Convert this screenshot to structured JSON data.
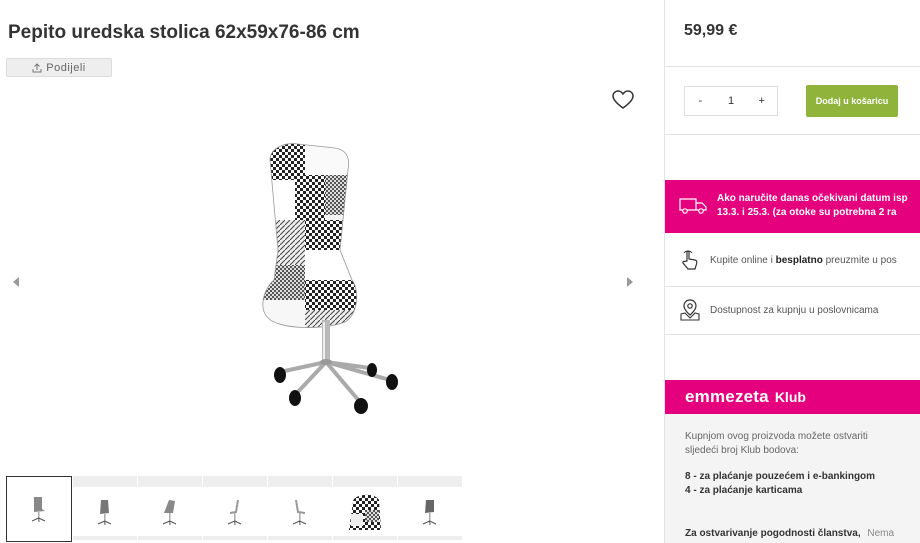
{
  "product": {
    "title": "Pepito uredska stolica 62x59x76-86 cm",
    "share_label": "Podijeli"
  },
  "gallery": {
    "thumbnail_count": 7,
    "active_index": 0
  },
  "purchase": {
    "price": "59,99 €",
    "qty_minus": "-",
    "qty_value": "1",
    "qty_plus": "+",
    "add_to_cart_label": "Dodaj u košaricu"
  },
  "delivery_notice": {
    "line1": "Ako naručite danas očekivani datum isp",
    "line2": "13.3. i 25.3. (za otoke su potrebna 2 ra"
  },
  "pickup": {
    "prefix": "Kupite online i ",
    "bold": "besplatno",
    "suffix": " preuzmite u pos"
  },
  "availability": {
    "label": "Dostupnost za kupnju u poslovnicama"
  },
  "club": {
    "brand": "emmezeta",
    "suffix": "Klub",
    "intro_line1": "Kupnjom ovog proizvoda možete ostvariti",
    "intro_line2": "sljedeći broj Klub bodova:",
    "points1": "8 - za plaćanje pouzećem i e-bankingom",
    "points2": "4 - za plaćanje karticama",
    "membership_bold": "Za ostvarivanje pogodnosti članstva,",
    "membership_rest": "Nema"
  },
  "colors": {
    "brand_pink": "#e5007e",
    "cart_green": "#8fb33b"
  }
}
